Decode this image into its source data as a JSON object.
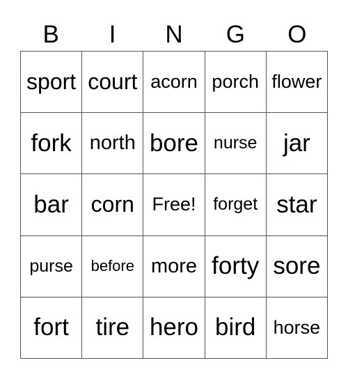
{
  "header": {
    "letters": [
      "B",
      "I",
      "N",
      "G",
      "O"
    ]
  },
  "board": {
    "rows": [
      [
        "sport",
        "court",
        "acorn",
        "porch",
        "flower"
      ],
      [
        "fork",
        "north",
        "bore",
        "nurse",
        "jar"
      ],
      [
        "bar",
        "corn",
        "Free!",
        "forget",
        "star"
      ],
      [
        "purse",
        "before",
        "more",
        "forty",
        "sore"
      ],
      [
        "fort",
        "tire",
        "hero",
        "bird",
        "horse"
      ]
    ]
  }
}
